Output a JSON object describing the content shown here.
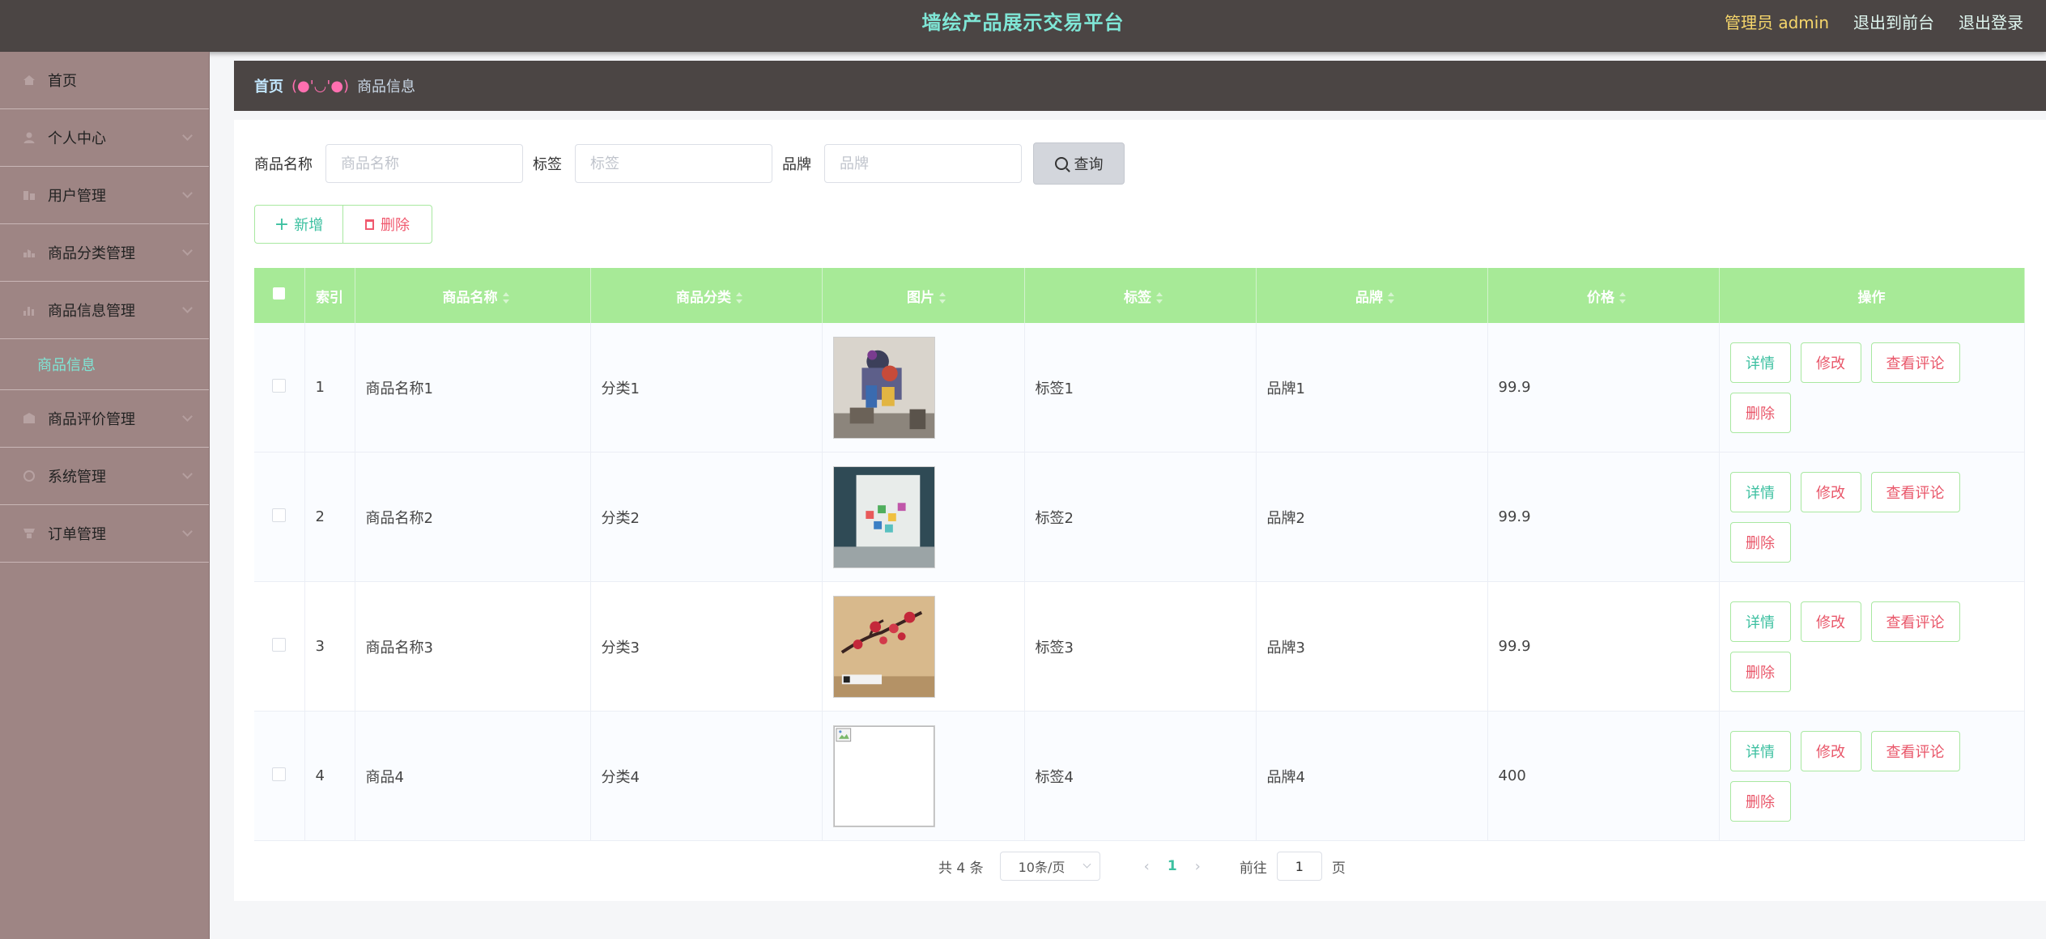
{
  "header": {
    "title": "墙绘产品展示交易平台",
    "role": "管理员 admin",
    "links": [
      "退出到前台",
      "退出登录"
    ]
  },
  "sidebar": {
    "items": [
      {
        "label": "首页",
        "icon": "home-icon"
      },
      {
        "label": "个人中心",
        "icon": "user-icon"
      },
      {
        "label": "用户管理",
        "icon": "users-icon"
      },
      {
        "label": "商品分类管理",
        "icon": "category-icon"
      },
      {
        "label": "商品信息管理",
        "icon": "chart-icon"
      },
      {
        "label": "商品评价管理",
        "icon": "comment-icon"
      },
      {
        "label": "系统管理",
        "icon": "settings-icon"
      },
      {
        "label": "订单管理",
        "icon": "order-icon"
      }
    ],
    "submenu": {
      "label": "商品信息"
    }
  },
  "breadcrumb": {
    "home": "首页",
    "separator": "(●'◡'●)",
    "current": "商品信息"
  },
  "search": {
    "name_label": "商品名称",
    "name_placeholder": "商品名称",
    "tag_label": "标签",
    "tag_placeholder": "标签",
    "brand_label": "品牌",
    "brand_placeholder": "品牌",
    "query_label": "查询"
  },
  "actions": {
    "add_label": "新增",
    "delete_label": "删除"
  },
  "table": {
    "columns": [
      "索引",
      "商品名称",
      "商品分类",
      "图片",
      "标签",
      "品牌",
      "价格",
      "操作"
    ],
    "rows": [
      {
        "index": "1",
        "name": "商品名称1",
        "category": "分类1",
        "image": "painting-1",
        "tag": "标签1",
        "brand": "品牌1",
        "price": "99.9"
      },
      {
        "index": "2",
        "name": "商品名称2",
        "category": "分类2",
        "image": "painting-2",
        "tag": "标签2",
        "brand": "品牌2",
        "price": "99.9"
      },
      {
        "index": "3",
        "name": "商品名称3",
        "category": "分类3",
        "image": "painting-3",
        "tag": "标签3",
        "brand": "品牌3",
        "price": "99.9"
      },
      {
        "index": "4",
        "name": "商品4",
        "category": "分类4",
        "image": "broken-image",
        "tag": "标签4",
        "brand": "品牌4",
        "price": "400"
      }
    ],
    "row_actions": {
      "detail": "详情",
      "edit": "修改",
      "review": "查看评论",
      "delete": "删除"
    }
  },
  "pagination": {
    "total": "共 4 条",
    "page_size": "10条/页",
    "prev": "‹",
    "current": "1",
    "next": "›",
    "goto_label": "前往",
    "goto_value": "1",
    "page_unit": "页"
  },
  "colors": {
    "header_bg": "#4b4544",
    "sidebar_bg": "#9e8584",
    "title_accent": "#7fe6d6",
    "table_header": "#a7ea97",
    "primary_text": "#3cc0a0",
    "danger_text": "#e9576a"
  }
}
